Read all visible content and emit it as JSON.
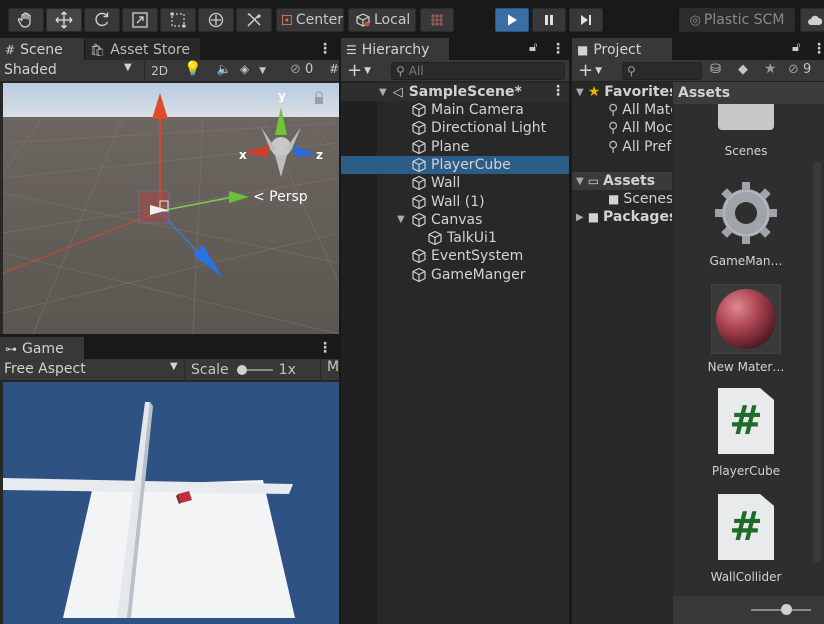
{
  "toolbar": {
    "pivot_label": "Center",
    "space_label": "Local",
    "plastic_label": "Plastic SCM"
  },
  "scene": {
    "tab_label": "Scene",
    "asset_store_tab_label": "Asset Store",
    "shading_mode": "Shaded",
    "mode_2d_label": "2D",
    "hidden_count": "0",
    "persp_label": "< Persp",
    "gizmo_labels": {
      "y": "y",
      "x": "x",
      "z": "z"
    }
  },
  "game": {
    "tab_label": "Game",
    "aspect": "Free Aspect",
    "scale_label": "Scale",
    "scale_value": "1x",
    "cut_label": "M"
  },
  "hierarchy": {
    "tab_label": "Hierarchy",
    "search_placeholder": "All",
    "scene_name": "SampleScene*",
    "items": [
      {
        "label": "Main Camera",
        "depth": 1,
        "selected": false,
        "expandable": false
      },
      {
        "label": "Directional Light",
        "depth": 1,
        "selected": false,
        "expandable": false
      },
      {
        "label": "Plane",
        "depth": 1,
        "selected": false,
        "expandable": false
      },
      {
        "label": "PlayerCube",
        "depth": 1,
        "selected": true,
        "expandable": false
      },
      {
        "label": "Wall",
        "depth": 1,
        "selected": false,
        "expandable": false
      },
      {
        "label": "Wall (1)",
        "depth": 1,
        "selected": false,
        "expandable": false
      },
      {
        "label": "Canvas",
        "depth": 1,
        "selected": false,
        "expandable": true
      },
      {
        "label": "TalkUi1",
        "depth": 2,
        "selected": false,
        "expandable": false
      },
      {
        "label": "EventSystem",
        "depth": 1,
        "selected": false,
        "expandable": false
      },
      {
        "label": "GameManger",
        "depth": 1,
        "selected": false,
        "expandable": false
      }
    ]
  },
  "project": {
    "tab_label": "Project",
    "hidden_count": "9",
    "favorites_label": "Favorites",
    "favorites_items": [
      "All Mate",
      "All Moc",
      "All Pref"
    ],
    "assets_folder_label": "Assets",
    "assets_subfolders": [
      "Scenes"
    ],
    "packages_label": "Packages",
    "assets_header": "Assets",
    "assets": [
      {
        "name": "Scenes",
        "kind": "folder"
      },
      {
        "name": "GameMan…",
        "kind": "gear"
      },
      {
        "name": "New Mater…",
        "kind": "material"
      },
      {
        "name": "PlayerCube",
        "kind": "script"
      },
      {
        "name": "WallCollider",
        "kind": "script"
      }
    ],
    "script_glyph": "#"
  },
  "colors": {
    "accent_selection": "#2c5d87",
    "play_button": "#3a6ea5",
    "game_sky": "#2f5284",
    "material_sphere": "#a8414f"
  }
}
